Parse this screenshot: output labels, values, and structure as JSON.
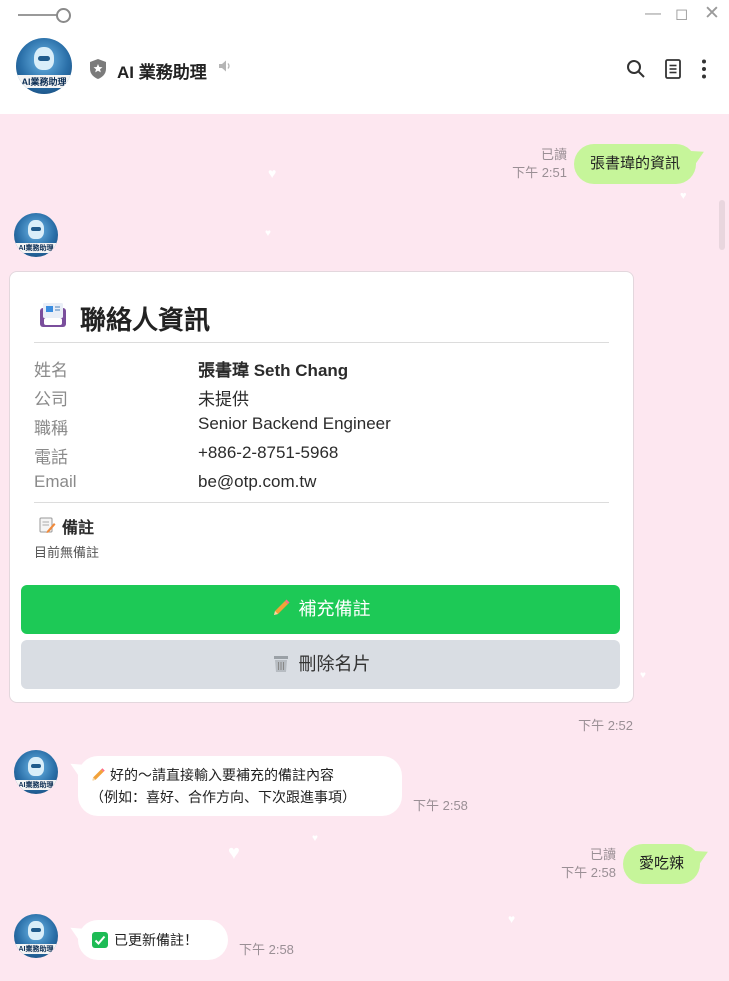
{
  "header": {
    "title": "AI 業務助理",
    "avatar_caption": "AI業務助理"
  },
  "messages": {
    "m1": {
      "text": "張書瑋的資訊",
      "read": "已讀",
      "time": "下午 2:51"
    },
    "card": {
      "title": "聯絡人資訊",
      "rows": [
        {
          "label": "姓名",
          "value": "張書瑋 Seth Chang"
        },
        {
          "label": "公司",
          "value": "未提供"
        },
        {
          "label": "職稱",
          "value": "Senior Backend Engineer"
        },
        {
          "label": "電話",
          "value": "+886-2-8751-5968"
        },
        {
          "label": "Email",
          "value": "be@otp.com.tw"
        }
      ],
      "note_title": "備註",
      "note_body": "目前無備註",
      "add_note_button": "補充備註",
      "delete_button": "刪除名片",
      "time": "下午 2:52"
    },
    "m3": {
      "line1": "好的～請直接輸入要補充的備註內容",
      "line2": "（例如：喜好、合作方向、下次跟進事項）",
      "time": "下午 2:58"
    },
    "m4": {
      "text": "愛吃辣",
      "read": "已讀",
      "time": "下午 2:58"
    },
    "m5": {
      "text": "已更新備註！",
      "time": "下午 2:58"
    }
  },
  "colors": {
    "chat_bg": "#fde7f0",
    "outgoing_bubble": "#c6f59a",
    "primary_button": "#1dc956",
    "secondary_button": "#d9dde3"
  },
  "icons": [
    "shield-icon",
    "speaker-icon",
    "search-icon",
    "notes-icon",
    "more-icon",
    "pencil-icon",
    "trash-icon",
    "check-icon",
    "contact-card-icon",
    "memo-icon"
  ]
}
